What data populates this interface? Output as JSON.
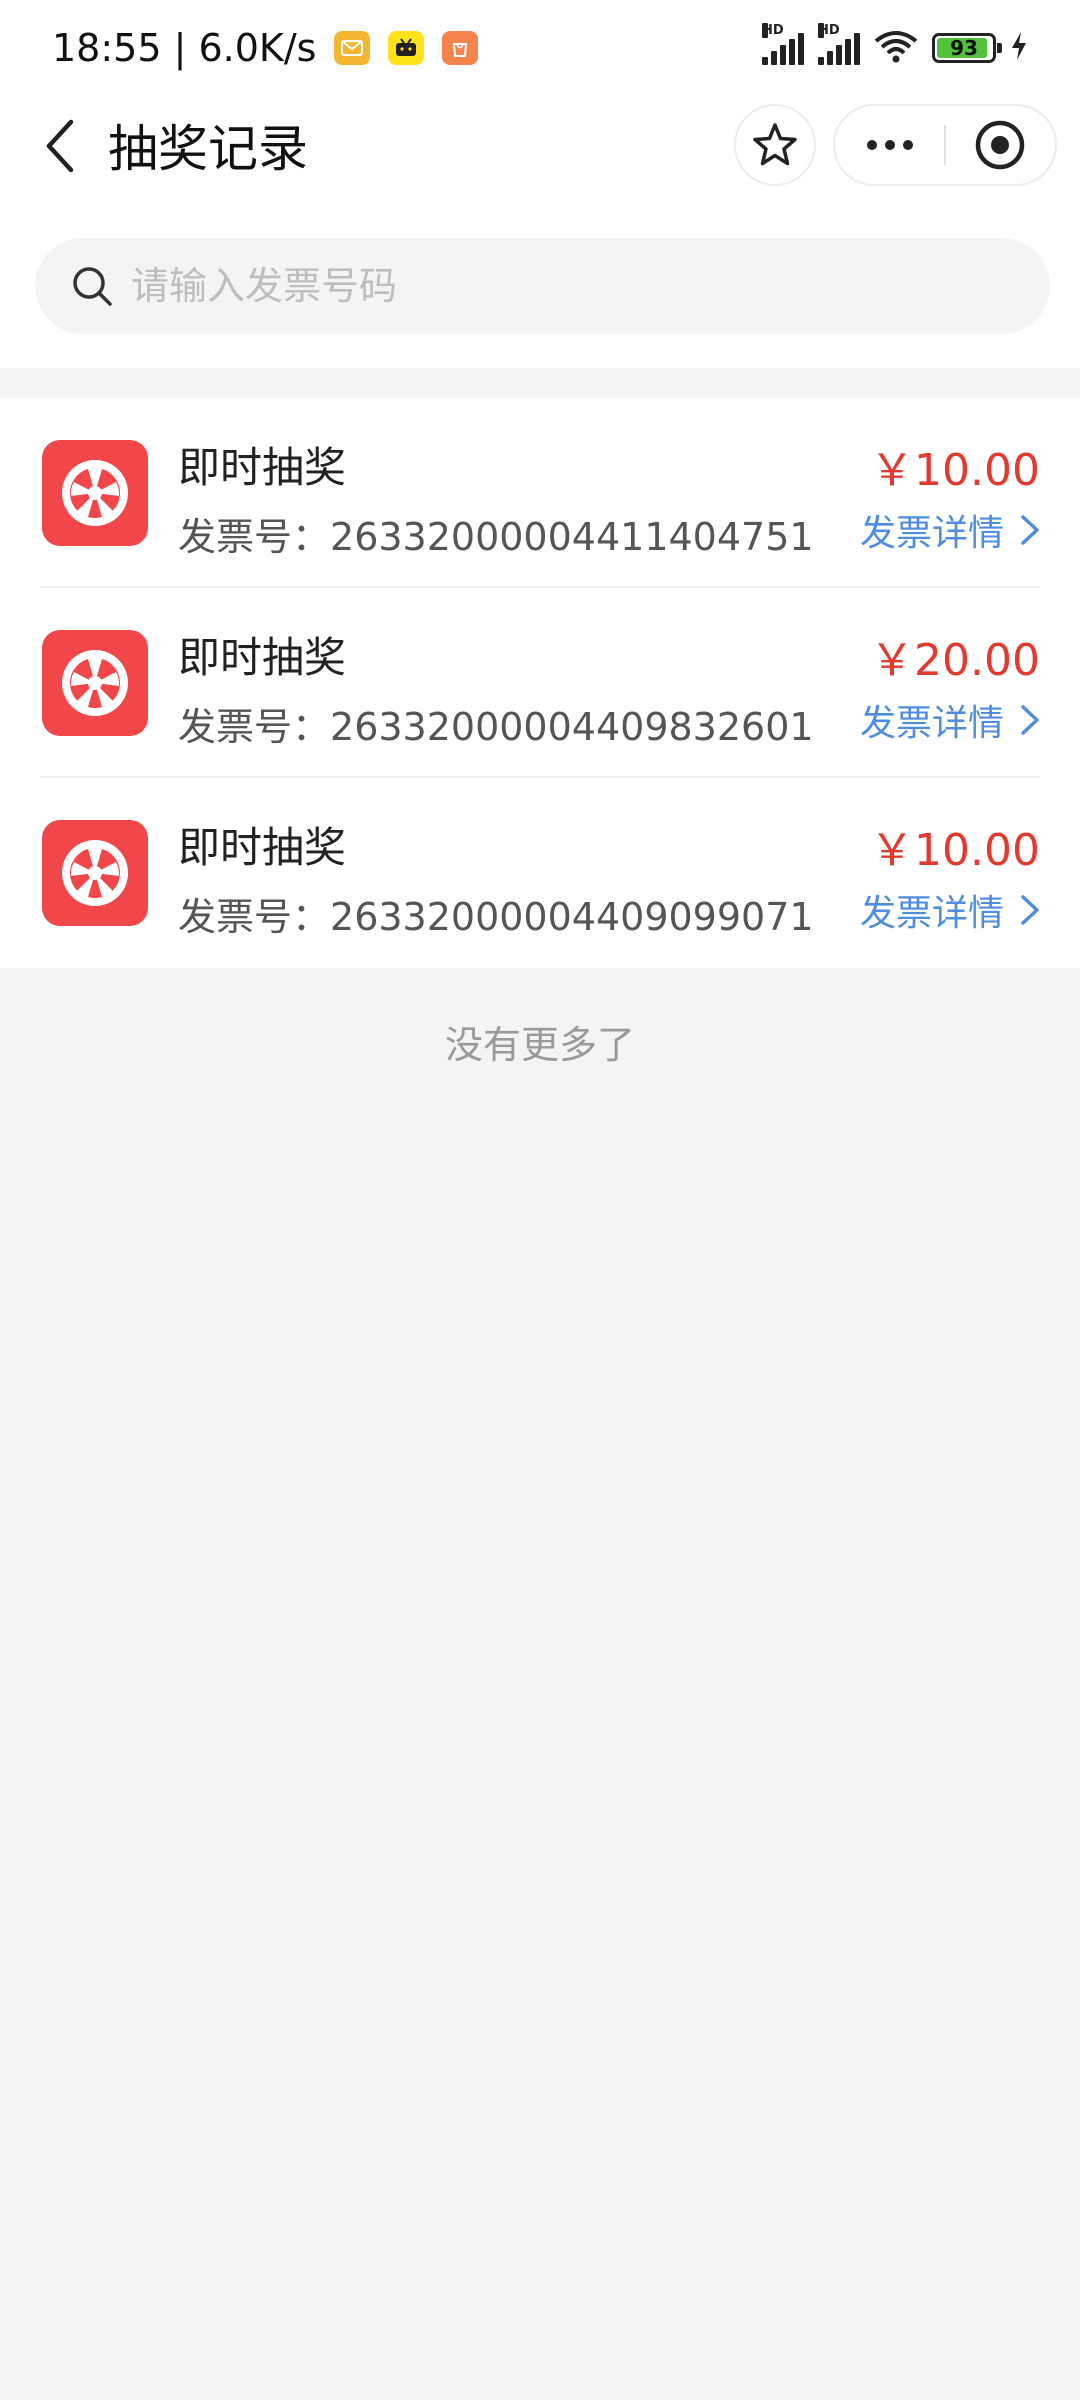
{
  "status_bar": {
    "time_speed": "18:55 | 6.0K/s",
    "network_label": "HD",
    "battery": "93"
  },
  "nav": {
    "title": "抽奖记录"
  },
  "search": {
    "placeholder": "请输入发票号码"
  },
  "records": [
    {
      "title": "即时抽奖",
      "invoice_label": "发票号：",
      "invoice_no": "26332000004411404751",
      "amount": "￥10.00",
      "detail_label": "发票详情"
    },
    {
      "title": "即时抽奖",
      "invoice_label": "发票号：",
      "invoice_no": "26332000004409832601",
      "amount": "￥20.00",
      "detail_label": "发票详情"
    },
    {
      "title": "即时抽奖",
      "invoice_label": "发票号：",
      "invoice_no": "26332000004409099071",
      "amount": "￥10.00",
      "detail_label": "发票详情"
    }
  ],
  "footer": {
    "no_more": "没有更多了"
  },
  "colors": {
    "accent_red": "#e23a2f",
    "link_blue": "#4e8de0",
    "icon_red": "#f2474a"
  },
  "icons": {
    "back": "chevron-left-icon",
    "favorite": "star-icon",
    "more": "more-dots-icon",
    "close": "target-circle-icon",
    "search": "search-icon",
    "wheel": "prize-wheel-icon",
    "detail": "chevron-right-icon"
  }
}
